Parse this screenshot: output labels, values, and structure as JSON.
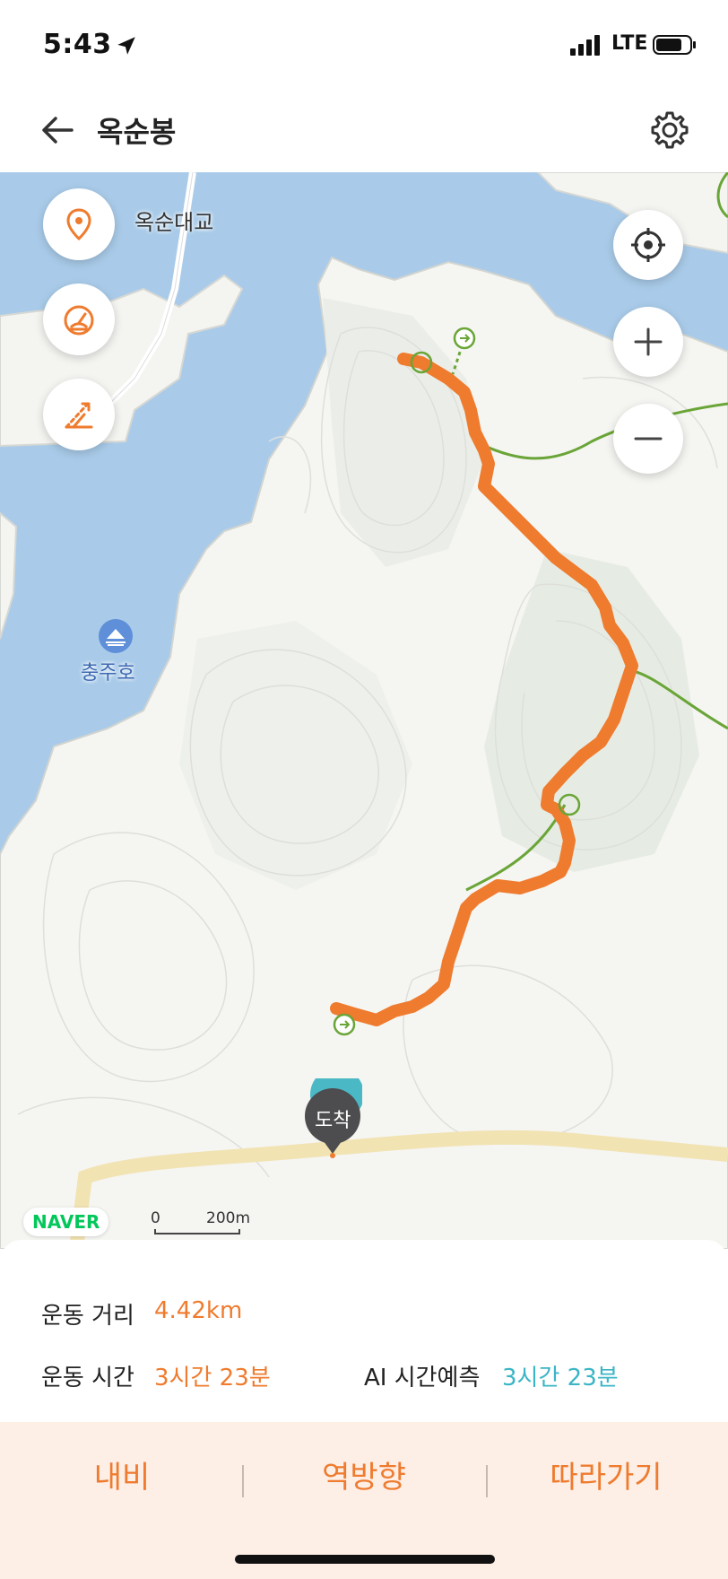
{
  "status": {
    "time": "5:43",
    "network": "LTE"
  },
  "header": {
    "title": "옥순봉"
  },
  "map": {
    "place_label": "옥순대교",
    "lake_label": "충주호",
    "arrive_label": "도착",
    "naver_label": "NAVER",
    "scale_zero": "0",
    "scale_distance": "200m",
    "route_color": "#ef7b2e",
    "trail_color": "#6aa537"
  },
  "stats": {
    "distance_label": "운동 거리",
    "distance_value": "4.42km",
    "time_label": "운동 시간",
    "time_value": "3시간 23분",
    "ai_label": "AI 시간예측",
    "ai_value": "3시간 23분"
  },
  "actions": {
    "navigate": "내비",
    "reverse": "역방향",
    "follow": "따라가기"
  },
  "colors": {
    "accent": "#ef7b2e",
    "ai_accent": "#3bb5c6",
    "action_bar_bg": "#fdeee6"
  }
}
